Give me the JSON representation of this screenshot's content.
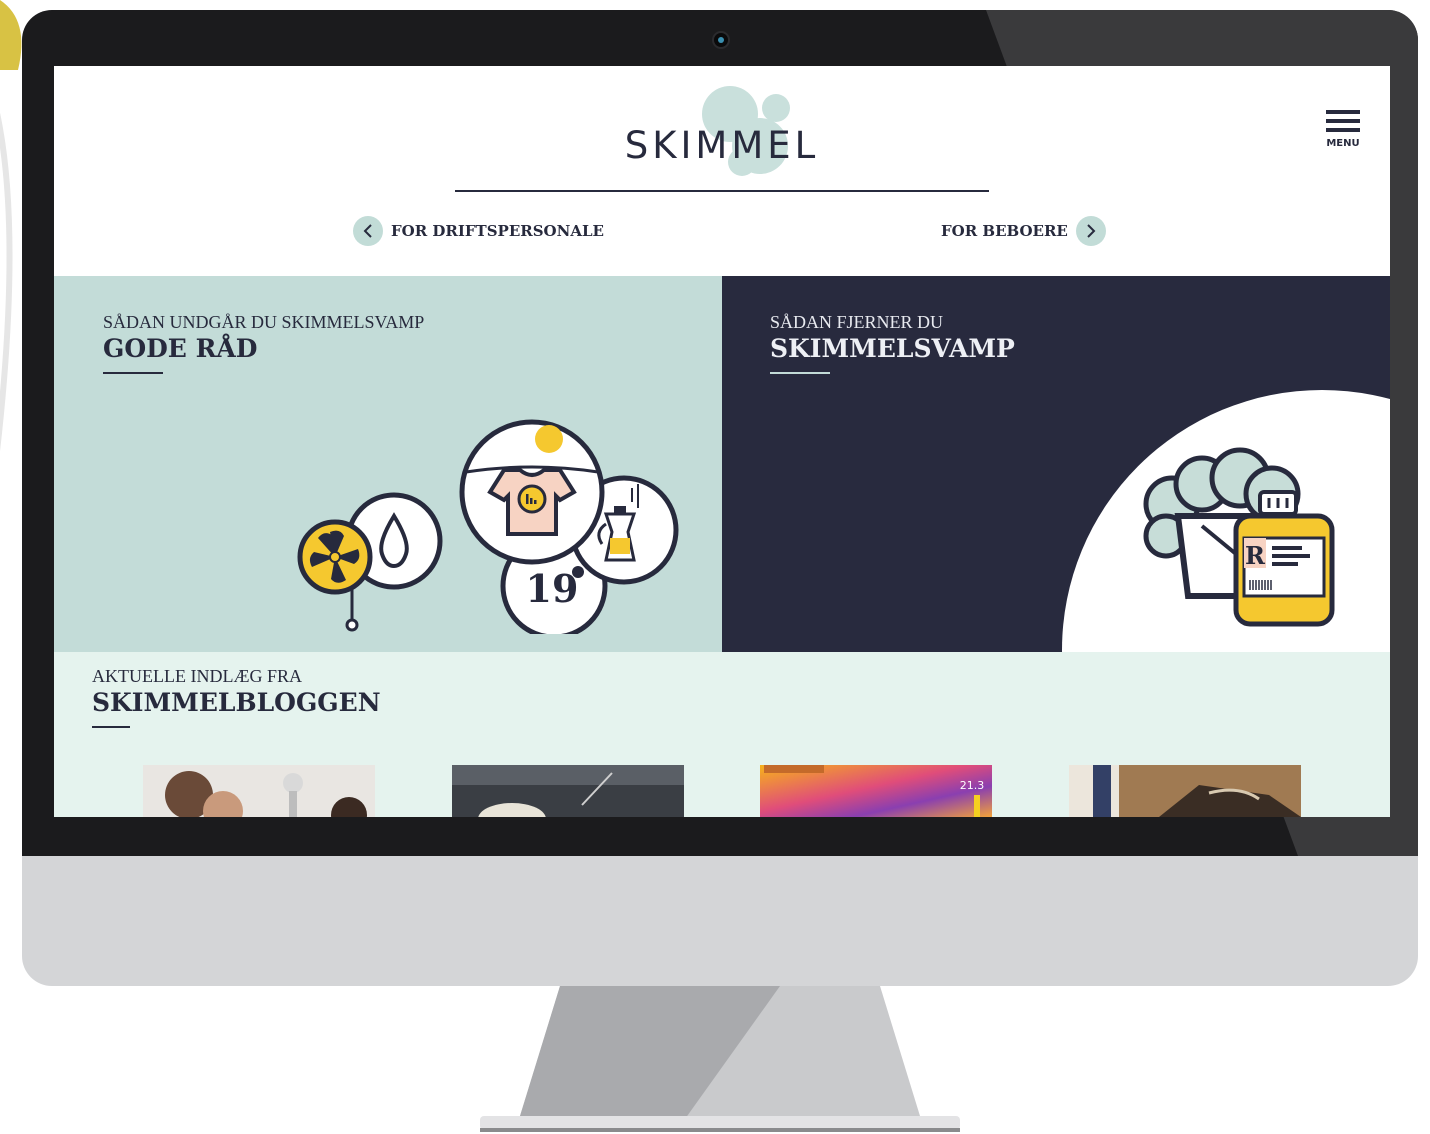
{
  "brand": {
    "name": "SKIMMEL"
  },
  "menu": {
    "label": "MENU",
    "icon": "hamburger-icon"
  },
  "audience_nav": {
    "prev": {
      "label": "FOR DRIFTSPERSONALE",
      "icon": "chevron-left-icon"
    },
    "next": {
      "label": "FOR BEBOERE",
      "icon": "chevron-right-icon"
    }
  },
  "panels": {
    "advice": {
      "kicker": "SÅDAN UNDGÅR DU SKIMMELSVAMP",
      "title": "GODE RÅD"
    },
    "removal": {
      "kicker": "SÅDAN FJERNER DU",
      "title": "SKIMMELSVAMP"
    }
  },
  "illustration": {
    "temperature": "19"
  },
  "blog": {
    "kicker": "AKTUELLE INDLÆG FRA",
    "title": "SKIMMELBLOGGEN",
    "thermal_reading": "21.3"
  },
  "colors": {
    "navy": "#272a3d",
    "mint": "#c3dcd8",
    "light_mint": "#e5f3ee",
    "yellow": "#f5c82f",
    "bezel": "#1b1b1d",
    "chin": "#d4d5d7"
  }
}
